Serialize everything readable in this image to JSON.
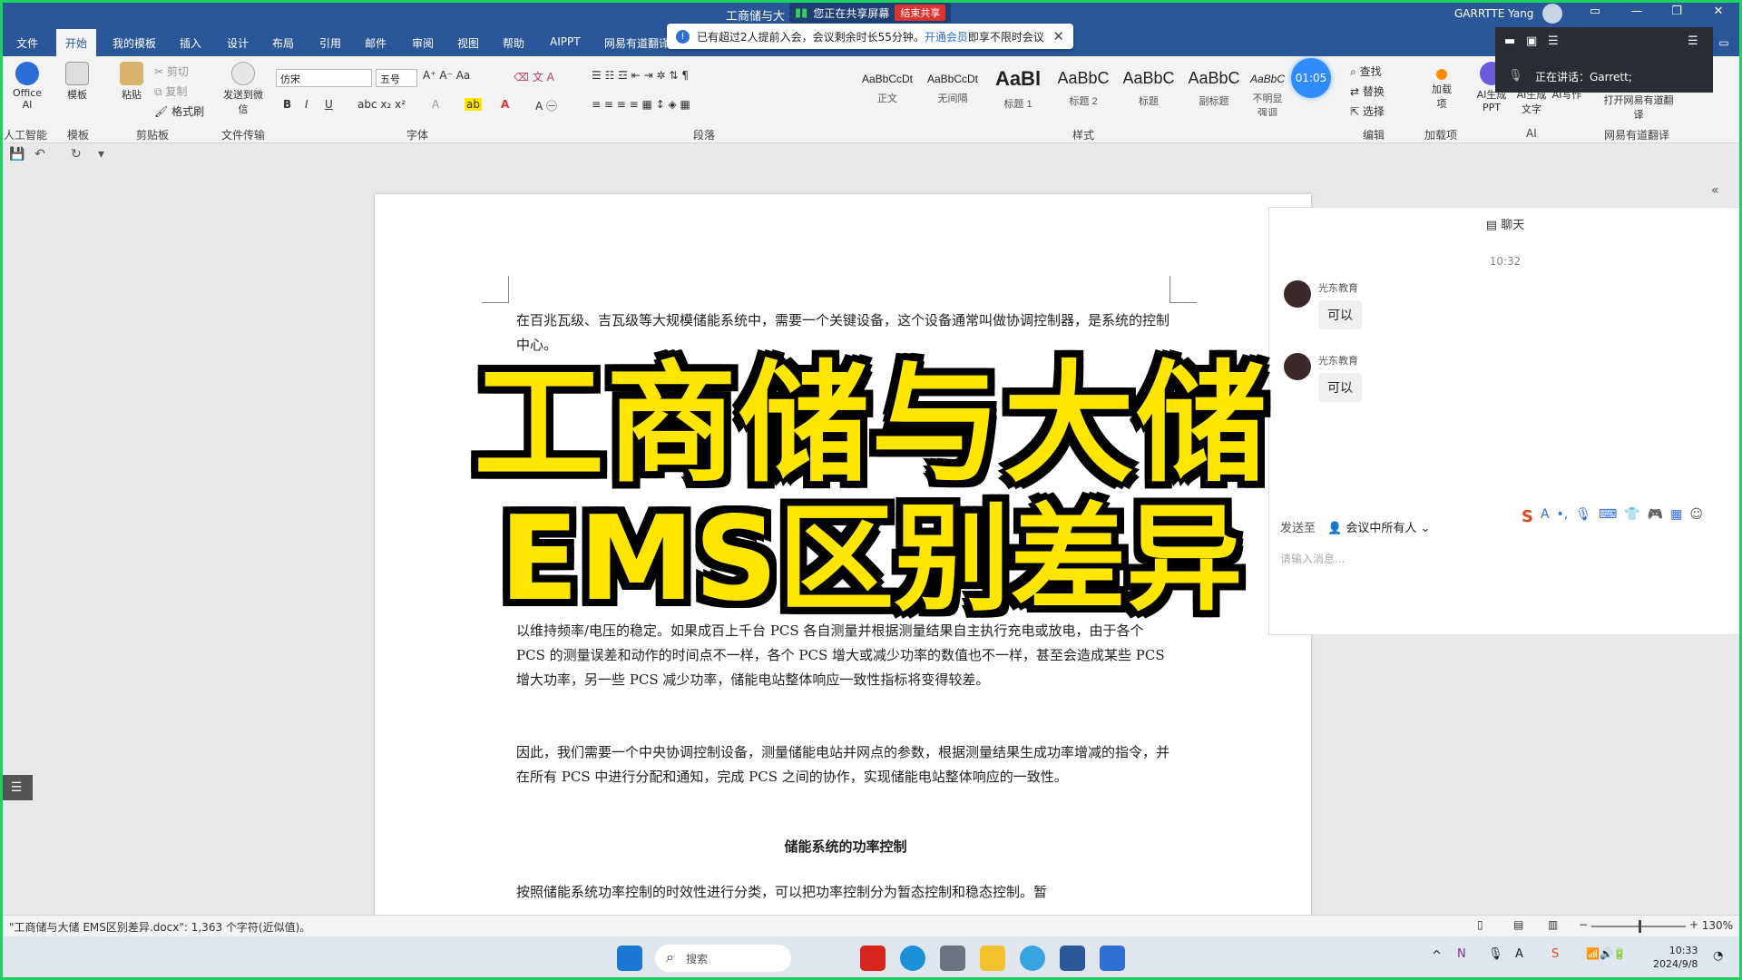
{
  "window": {
    "title": "工商储与大  - Word",
    "share_status": "您正在共享屏幕",
    "stop_share": "结束共享",
    "user": "GARRTTE Yang"
  },
  "tabs": [
    "文件",
    "开始",
    "我的模板",
    "插入",
    "设计",
    "布局",
    "引用",
    "邮件",
    "审阅",
    "视图",
    "帮助",
    "AIPPT",
    "网易有道翻译"
  ],
  "active_tab": "开始",
  "notice": {
    "text": "已有超过2人提前入会，会议剩余时长55分钟。",
    "link": "开通会员",
    "tail": "即享不限时会议"
  },
  "timer": "01:05",
  "ribbon": {
    "office_ai": "Office AI",
    "ai_group": "人工智能",
    "template": "模板",
    "template_group": "模板",
    "paste": "粘贴",
    "cut": "剪切",
    "copy": "复制",
    "format_painter": "格式刷",
    "clipboard_group": "剪贴板",
    "send_label": "发送到微信",
    "transfer_group": "文件传输",
    "font_name": "仿宋",
    "font_size": "五号",
    "font_group": "字体",
    "paragraph_group": "段落",
    "styles_group": "样式",
    "styles": [
      {
        "sample": "AaBbCcDt",
        "name": "正文",
        "kind": "normal"
      },
      {
        "sample": "AaBbCcDt",
        "name": "无间隔",
        "kind": "normal"
      },
      {
        "sample": "AaBl",
        "name": "标题 1",
        "kind": "h1"
      },
      {
        "sample": "AaBbC",
        "name": "标题 2",
        "kind": "h2"
      },
      {
        "sample": "AaBbC",
        "name": "标题",
        "kind": "h2"
      },
      {
        "sample": "AaBbC",
        "name": "副标题",
        "kind": "h2"
      },
      {
        "sample": "AaBbC",
        "name": "不明显强调",
        "kind": "normal"
      }
    ],
    "find": "查找",
    "replace": "替换",
    "select": "选择",
    "edit_group": "编辑",
    "addin": "加载项",
    "addin_group": "加载项",
    "ai_ppt": "AI生成PPT",
    "ai_text": "AI生成文字",
    "ai_write": "AI写作",
    "ai_group2": "AI",
    "youdao": "打开网易有道翻译",
    "youdao_group": "网易有道翻译"
  },
  "meeting": {
    "speaking": "正在讲话：Garrett;"
  },
  "document": {
    "p1": "在百兆瓦级、吉瓦级等大规模储能系统中，需要一个关键设备，这个设备通常叫做协调控制器，是系统的控制中心。",
    "p3": "以维持频率/电压的稳定。如果成百上千台 PCS 各自测量并根据测量结果自主执行充电或放电，由于各个 PCS 的测量误差和动作的时间点不一样，各个 PCS 增大或减少功率的数值也不一样，甚至会造成某些 PCS 增大功率，另一些 PCS 减少功率，储能电站整体响应一致性指标将变得较差。",
    "p4": "因此，我们需要一个中央协调控制设备，测量储能电站并网点的参数，根据测量结果生成功率增减的指令，并在所有 PCS 中进行分配和通知，完成 PCS 之间的协作，实现储能电站整体响应的一致性。",
    "heading": "储能系统的功率控制",
    "p5": "按照储能系统功率控制的时效性进行分类，可以把功率控制分为暂态控制和稳态控制。暂"
  },
  "overlay": {
    "line1": "工商储与大储",
    "line2": "EMS区别差异"
  },
  "chat": {
    "header": "聊天",
    "time": "10:32",
    "messages": [
      {
        "sender": "光东教育",
        "text": "可以"
      },
      {
        "sender": "光东教育",
        "text": "可以"
      }
    ],
    "send_to": "发送至",
    "recipients": "会议中所有人",
    "placeholder": "请输入消息..."
  },
  "status": {
    "doc_info": "\"工商储与大储 EMS区别差异.docx\": 1,363 个字符(近似值)。",
    "zoom": "130%"
  },
  "taskbar": {
    "search": "搜索",
    "time": "10:33",
    "date": "2024/9/8"
  },
  "colors": {
    "ribbon_blue": "#2b579a",
    "overlay_yellow": "#ffe600",
    "frame_green": "#20d060"
  }
}
